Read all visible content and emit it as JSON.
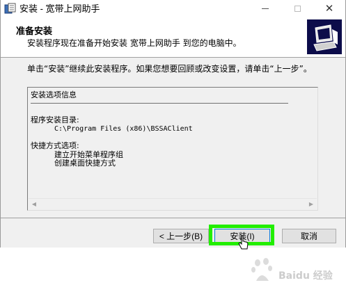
{
  "window": {
    "title": "安装 - 宽带上网助手"
  },
  "header": {
    "title": "准备安装",
    "subtitle": "安装程序现在准备开始安装 宽带上网助手 到您的电脑中。"
  },
  "instruction": "单击“安装”继续此安装程序。如果您想要回顾或改变设置，请单击“上一步”。",
  "memo": {
    "heading": "安装选项信息",
    "install_dir_label": "程序安装目录:",
    "install_dir_value": "C:\\Program Files (x86)\\BSSAClient",
    "shortcut_label": "快捷方式选项:",
    "shortcut_items": [
      "建立开始菜单程序组",
      "创建桌面快捷方式"
    ]
  },
  "buttons": {
    "back": "< 上一步(B)",
    "install": "安装(I)",
    "cancel": "取消"
  },
  "colors": {
    "highlight": "#22ee00",
    "header_graphic": "#0c0c4a"
  }
}
